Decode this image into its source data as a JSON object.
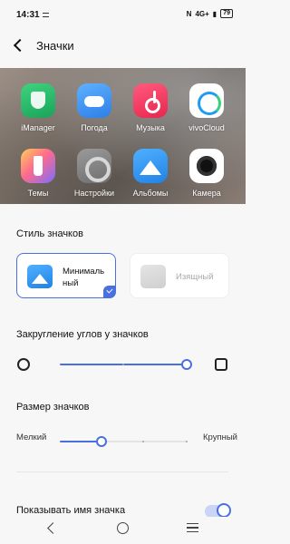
{
  "status_bar": {
    "time": "14:31",
    "network": "4G+",
    "signal_note": "N",
    "battery": "79"
  },
  "header": {
    "title": "Значки"
  },
  "preview": {
    "apps": [
      {
        "label": "iManager",
        "icon": "shield-icon"
      },
      {
        "label": "Погода",
        "icon": "cloud-icon"
      },
      {
        "label": "Музыка",
        "icon": "music-note-icon"
      },
      {
        "label": "vivoCloud",
        "icon": "cloud-sync-icon"
      },
      {
        "label": "Темы",
        "icon": "brush-icon"
      },
      {
        "label": "Настройки",
        "icon": "gear-icon"
      },
      {
        "label": "Альбомы",
        "icon": "mountain-icon"
      },
      {
        "label": "Камера",
        "icon": "camera-lens-icon"
      }
    ]
  },
  "icon_style": {
    "label": "Стиль значков",
    "options": [
      {
        "name": "Минималь ный",
        "selected": true
      },
      {
        "name": "Изящный",
        "selected": false
      }
    ]
  },
  "corner_rounding": {
    "label": "Закругление углов у значков",
    "value": 1.0
  },
  "icon_size": {
    "label": "Размер значков",
    "min_label": "Мелкий",
    "max_label": "Крупный",
    "value": 0.33
  },
  "show_name": {
    "label": "Показывать имя значка",
    "enabled": true
  },
  "colors": {
    "accent": "#4a6fe0"
  }
}
